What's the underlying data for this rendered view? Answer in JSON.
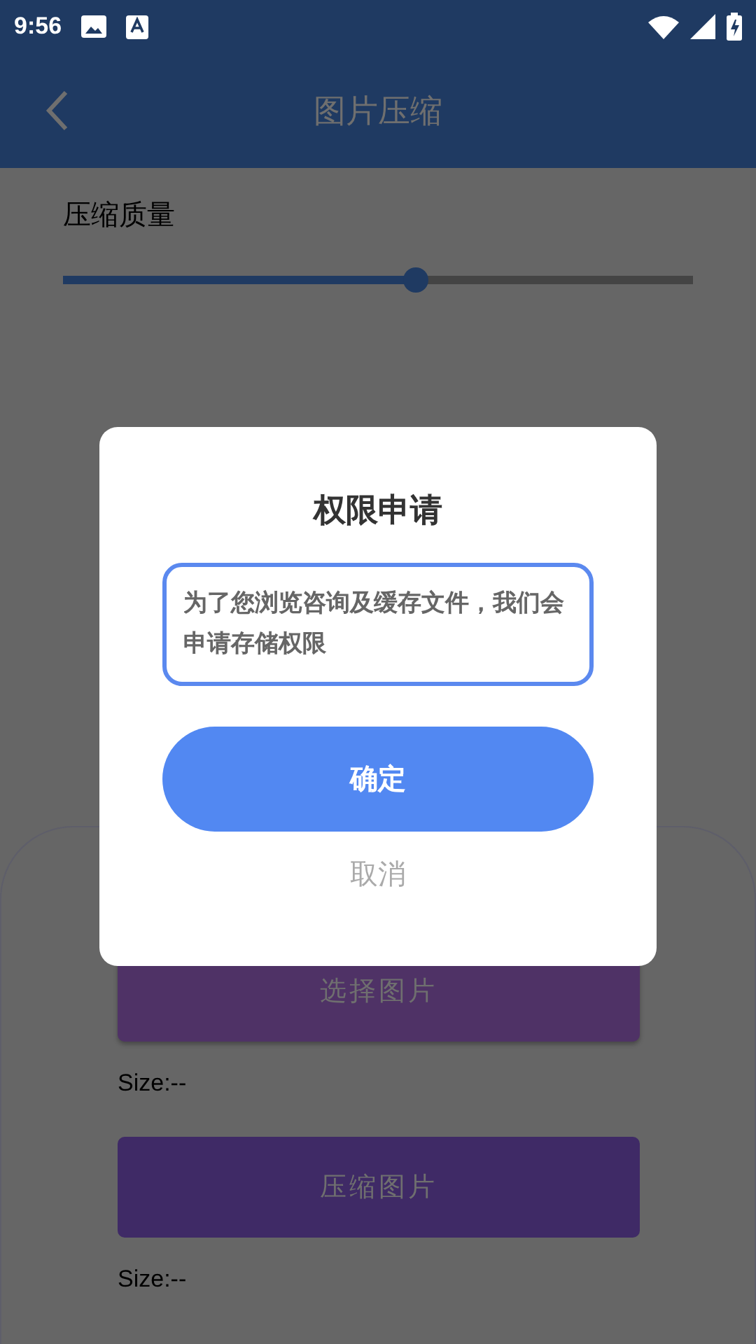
{
  "status_bar": {
    "time": "9:56"
  },
  "app_bar": {
    "title": "图片压缩"
  },
  "quality": {
    "label": "压缩质量",
    "level": 0.56
  },
  "actions": [
    {
      "label": "选择图片",
      "size": "Size:--"
    },
    {
      "label": "压缩图片",
      "size": "Size:--"
    }
  ],
  "dialog": {
    "title": "权限申请",
    "message": "为了您浏览咨询及缓存文件，我们会申请存储权限",
    "buttons": [
      {
        "label": "确定",
        "kind": "primary"
      },
      {
        "label": "取消",
        "kind": "text"
      }
    ]
  }
}
